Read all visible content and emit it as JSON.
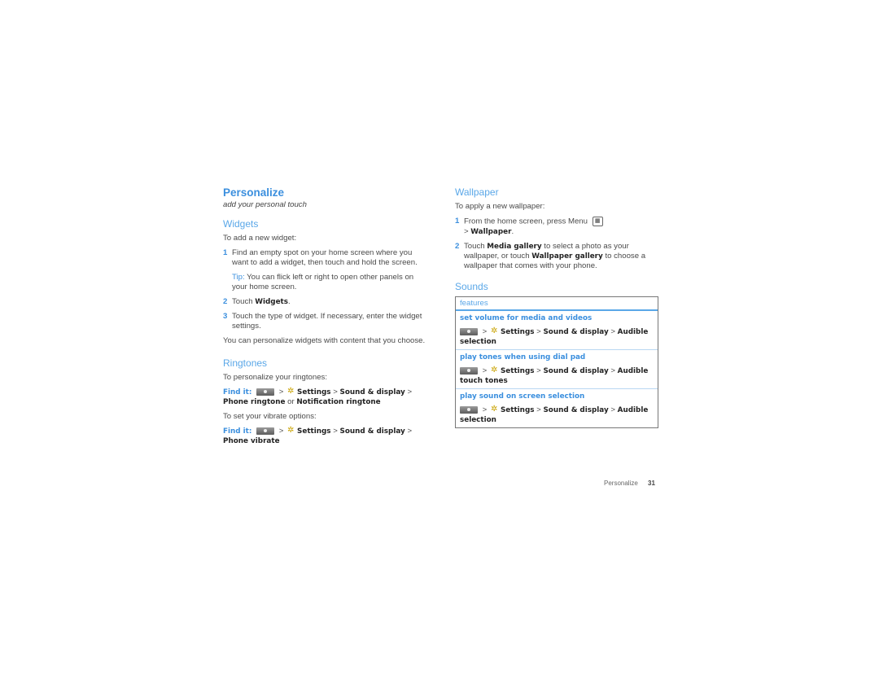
{
  "left": {
    "title": "Personalize",
    "subtitle": "add your personal touch",
    "widgets": {
      "heading": "Widgets",
      "intro": "To add a new widget:",
      "step1": "Find an empty spot on your home screen where you want to add a widget, then touch and hold the screen.",
      "tip_label": "Tip:",
      "tip_text": "You can flick left or right to open other panels on your home screen.",
      "step2_pre": "Touch",
      "step2_bold": "Widgets",
      "step2_post": ".",
      "step3": "Touch the type of widget. If necessary, enter the widget settings.",
      "outro": "You can personalize widgets with content that you choose."
    },
    "ringtones": {
      "heading": "Ringtones",
      "intro": "To personalize your ringtones:",
      "find_label": "Find it:",
      "path1_settings": "Settings",
      "path1_sound": "Sound & display",
      "path1_a": "Phone ringtone",
      "path1_or": "or",
      "path1_b": "Notification ringtone",
      "vibrate_intro": "To set your vibrate options:",
      "path2_settings": "Settings",
      "path2_sound": "Sound & display",
      "path2_end": "Phone vibrate"
    }
  },
  "right": {
    "wallpaper": {
      "heading": "Wallpaper",
      "intro": "To apply a new wallpaper:",
      "step1_text": "From the home screen, press Menu",
      "step1_bold": "Wallpaper",
      "step2_a": "Touch",
      "step2_b": "Media gallery",
      "step2_c": "to select a photo as your wallpaper, or touch",
      "step2_d": "Wallpaper gallery",
      "step2_e": "to choose a wallpaper that comes with your phone."
    },
    "sounds": {
      "heading": "Sounds",
      "table_header": "features",
      "rows": [
        {
          "title": "set volume for media and videos",
          "settings": "Settings",
          "sound": "Sound & display",
          "end": "Audible selection"
        },
        {
          "title": "play tones when using dial pad",
          "settings": "Settings",
          "sound": "Sound & display",
          "end": "Audible touch tones"
        },
        {
          "title": "play sound on screen selection",
          "settings": "Settings",
          "sound": "Sound & display",
          "end": "Audible selection"
        }
      ]
    }
  },
  "footer": {
    "section": "Personalize",
    "page": "31"
  },
  "icons": {
    "menu_key": "menu-key-icon",
    "gear": "settings-gear-icon",
    "menu": "menu-grid-icon"
  },
  "sep": ">"
}
